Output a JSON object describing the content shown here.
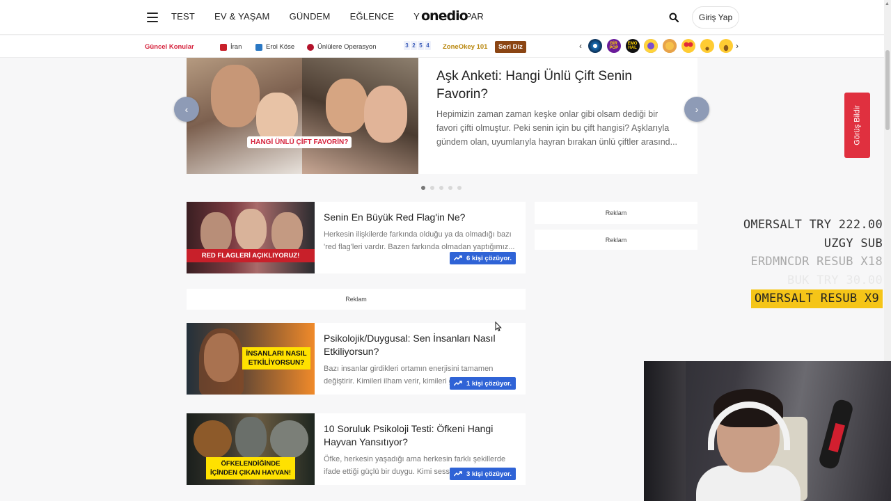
{
  "header": {
    "nav": [
      "TEST",
      "EV & YAŞAM",
      "GÜNDEM",
      "EĞLENCE",
      "YEMEK"
    ],
    "nav_partial": "PAR",
    "logo": "onedio",
    "login": "Giriş Yap"
  },
  "subnav": {
    "title": "Güncel Konular",
    "items": [
      "İran",
      "Erol Köse",
      "Ünlülere Operasyon"
    ],
    "number_tiles": [
      "3",
      "2",
      "5",
      "4"
    ],
    "zone": "ZoneOkey 101",
    "seri": "Seri Diz",
    "emoji_labels": [
      "BİR POP",
      "EMO HAL"
    ]
  },
  "slider": {
    "title": "Aşk Anketi: Hangi Ünlü Çift Senin Favorin?",
    "description": "Hepimizin zaman zaman keşke onlar gibi olsam dediği bir favori çifti olmuştur. Peki senin için bu çift hangisi? Aşklarıyla gündem olan, uyumlarıyla hayran bırakan ünlü çiftler arasınd...",
    "image_badge": "HANGİ ÜNLÜ ÇİFT FAVORİN?",
    "prev": "‹",
    "next": "›"
  },
  "cards": [
    {
      "title": "Senin En Büyük Red Flag'in Ne?",
      "description": "Herkesin ilişkilerde farkında olduğu ya da olmadığı bazı 'red flag'leri vardır. Bazen farkında olmadan yaptığımız...",
      "image_badge": "RED FLAGLERİ AÇIKLIYORUZ!",
      "solving": "6 kişi çözüyor."
    },
    {
      "title": "Psikolojik/Duygusal: Sen İnsanları Nasıl Etkiliyorsun?",
      "description": "Bazı insanlar girdikleri ortamın enerjisini tamamen değiştirir. Kimileri ilham verir, kimileri g",
      "image_badge": "İNSANLARI NASIL ETKİLİYORSUN?",
      "solving": "1 kişi çözüyor."
    },
    {
      "title": "10 Soruluk Psikoloji Testi: Öfkeni Hangi Hayvan Yansıtıyor?",
      "description": "Öfke, herkesin yaşadığı ama herkesin farklı şekillerde ifade ettiği güçlü bir duygu. Kimi sess",
      "image_badge": "ÖFKELENDİĞİNDE İÇİNDEN ÇIKAN HAYVAN!",
      "solving": "3 kişi çözüyor."
    }
  ],
  "ads": [
    "Reklam",
    "Reklam",
    "Reklam"
  ],
  "feedback": "Görüş Bildir",
  "stream_alerts": [
    "OMERSALT  TRY 222.00",
    "UZGY  SUB",
    "ERDMNCDR  RESUB X18",
    "BUK  TRY 30.00",
    "OMERSALT  RESUB X9"
  ],
  "colors": {
    "accent_red": "#d5223c",
    "solve_blue": "#2f63d6",
    "feedback_red": "#e0303f",
    "highlight_yellow": "#f5c518"
  }
}
